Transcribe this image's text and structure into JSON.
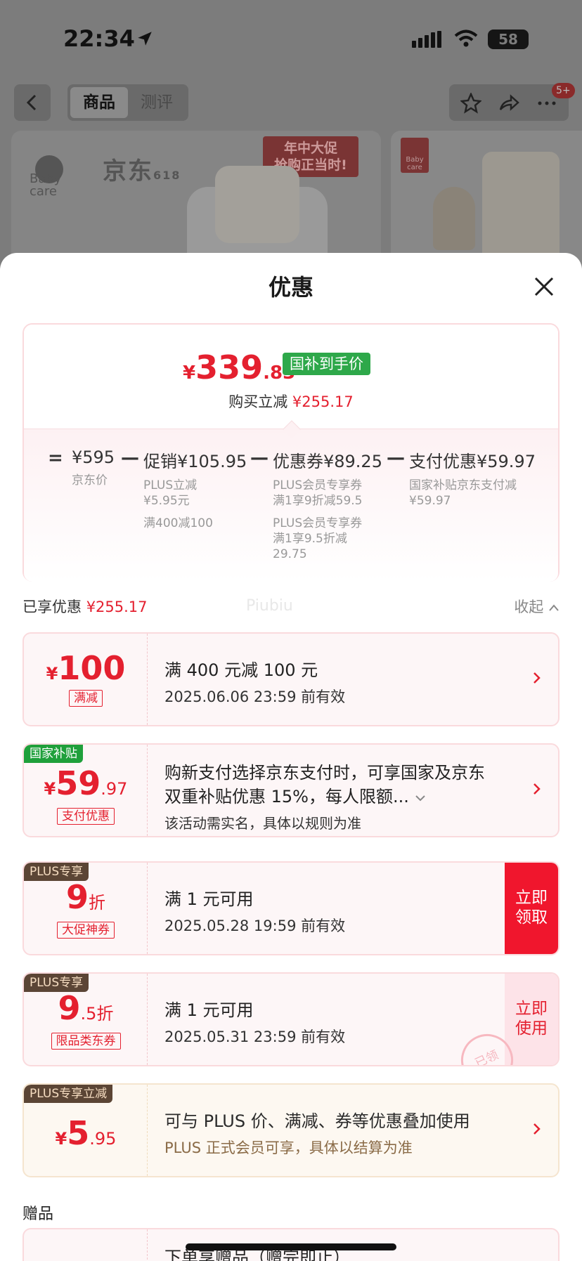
{
  "status_bar": {
    "time": "22:34",
    "battery": "58"
  },
  "top_nav": {
    "tabs": [
      "商品",
      "测评"
    ],
    "active_tab": 0,
    "badge": "5+"
  },
  "product_banner": {
    "brand": "Baby care",
    "partner_mark": "京东",
    "partner_sub": "618",
    "promo_line1": "年中大促",
    "promo_line2": "抢购正当时!",
    "thumb_brand": "Baby care"
  },
  "sheet": {
    "title": "优惠",
    "price": {
      "currency": "¥",
      "int": "339",
      "dec": ".83",
      "tag": "国补到手价",
      "reduce_label": "购买立减",
      "reduce_amount": "¥255.17"
    },
    "formula": {
      "eq": "=",
      "base_value": "¥595",
      "base_label": "京东价",
      "minus": "—",
      "promo_value": "促销¥105.95",
      "promo_items": [
        "PLUS立减\n¥5.95元",
        "满400减100"
      ],
      "coupon_value": "优惠券¥89.25",
      "coupon_items": [
        "PLUS会员专享券\n满1享9折减59.5",
        "PLUS会员专享券\n满1享9.5折减\n29.75"
      ],
      "pay_value": "支付优惠¥59.97",
      "pay_items": [
        "国家补贴京东支付减\n¥59.97"
      ]
    },
    "enjoyed": {
      "label": "已享优惠",
      "amount": "¥255.17",
      "watermark": "Piubiu",
      "collapse": "收起"
    },
    "coupons": [
      {
        "yen": "¥",
        "num": "100",
        "tag": "满减",
        "title": "满 400 元减 100 元",
        "sub": "2025.06.06 23:59 前有效"
      },
      {
        "corner": "国家补贴",
        "yen": "¥",
        "num": "59",
        "dec": ".97",
        "tag": "支付优惠",
        "title": "购新支付选择京东支付时，可享国家及京东",
        "title2": "双重补贴优惠 15%，每人限额...",
        "sub": "该活动需实名，具体以规则为准"
      },
      {
        "corner": "PLUS专享",
        "num": "9",
        "unit": "折",
        "tag": "大促神券",
        "title": "满 1 元可用",
        "sub": "2025.05.28 19:59 前有效",
        "action": "立即\n领取"
      },
      {
        "corner": "PLUS专享",
        "num": "9",
        "dec": ".5折",
        "tag": "限品类东券",
        "title": "满 1 元可用",
        "sub": "2025.05.31 23:59 前有效",
        "action": "立即\n使用",
        "stamp": "已领"
      },
      {
        "corner": "PLUS专享立减",
        "yen": "¥",
        "num": "5",
        "dec": ".95",
        "title": "可与 PLUS 价、满减、券等优惠叠加使用",
        "sub": "PLUS 正式会员可享，具体以结算为准"
      }
    ],
    "gift": {
      "label": "赠品",
      "title": "下单享赠品（赠完即止）"
    }
  },
  "colors": {
    "accent_red": "#e4202f",
    "gov_green": "#2ea84a",
    "plus_brown": "#5b4535"
  }
}
